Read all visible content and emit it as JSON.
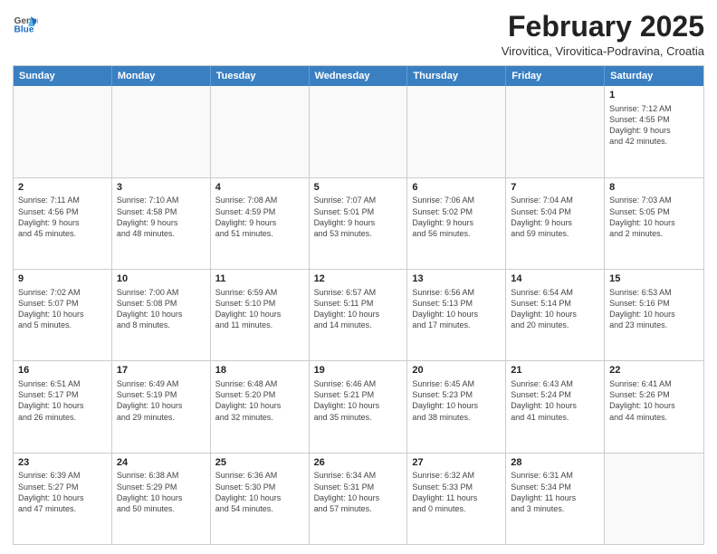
{
  "logo": {
    "general": "General",
    "blue": "Blue"
  },
  "header": {
    "month": "February 2025",
    "location": "Virovitica, Virovitica-Podravina, Croatia"
  },
  "weekdays": [
    "Sunday",
    "Monday",
    "Tuesday",
    "Wednesday",
    "Thursday",
    "Friday",
    "Saturday"
  ],
  "rows": [
    [
      {
        "day": "",
        "info": ""
      },
      {
        "day": "",
        "info": ""
      },
      {
        "day": "",
        "info": ""
      },
      {
        "day": "",
        "info": ""
      },
      {
        "day": "",
        "info": ""
      },
      {
        "day": "",
        "info": ""
      },
      {
        "day": "1",
        "info": "Sunrise: 7:12 AM\nSunset: 4:55 PM\nDaylight: 9 hours\nand 42 minutes."
      }
    ],
    [
      {
        "day": "2",
        "info": "Sunrise: 7:11 AM\nSunset: 4:56 PM\nDaylight: 9 hours\nand 45 minutes."
      },
      {
        "day": "3",
        "info": "Sunrise: 7:10 AM\nSunset: 4:58 PM\nDaylight: 9 hours\nand 48 minutes."
      },
      {
        "day": "4",
        "info": "Sunrise: 7:08 AM\nSunset: 4:59 PM\nDaylight: 9 hours\nand 51 minutes."
      },
      {
        "day": "5",
        "info": "Sunrise: 7:07 AM\nSunset: 5:01 PM\nDaylight: 9 hours\nand 53 minutes."
      },
      {
        "day": "6",
        "info": "Sunrise: 7:06 AM\nSunset: 5:02 PM\nDaylight: 9 hours\nand 56 minutes."
      },
      {
        "day": "7",
        "info": "Sunrise: 7:04 AM\nSunset: 5:04 PM\nDaylight: 9 hours\nand 59 minutes."
      },
      {
        "day": "8",
        "info": "Sunrise: 7:03 AM\nSunset: 5:05 PM\nDaylight: 10 hours\nand 2 minutes."
      }
    ],
    [
      {
        "day": "9",
        "info": "Sunrise: 7:02 AM\nSunset: 5:07 PM\nDaylight: 10 hours\nand 5 minutes."
      },
      {
        "day": "10",
        "info": "Sunrise: 7:00 AM\nSunset: 5:08 PM\nDaylight: 10 hours\nand 8 minutes."
      },
      {
        "day": "11",
        "info": "Sunrise: 6:59 AM\nSunset: 5:10 PM\nDaylight: 10 hours\nand 11 minutes."
      },
      {
        "day": "12",
        "info": "Sunrise: 6:57 AM\nSunset: 5:11 PM\nDaylight: 10 hours\nand 14 minutes."
      },
      {
        "day": "13",
        "info": "Sunrise: 6:56 AM\nSunset: 5:13 PM\nDaylight: 10 hours\nand 17 minutes."
      },
      {
        "day": "14",
        "info": "Sunrise: 6:54 AM\nSunset: 5:14 PM\nDaylight: 10 hours\nand 20 minutes."
      },
      {
        "day": "15",
        "info": "Sunrise: 6:53 AM\nSunset: 5:16 PM\nDaylight: 10 hours\nand 23 minutes."
      }
    ],
    [
      {
        "day": "16",
        "info": "Sunrise: 6:51 AM\nSunset: 5:17 PM\nDaylight: 10 hours\nand 26 minutes."
      },
      {
        "day": "17",
        "info": "Sunrise: 6:49 AM\nSunset: 5:19 PM\nDaylight: 10 hours\nand 29 minutes."
      },
      {
        "day": "18",
        "info": "Sunrise: 6:48 AM\nSunset: 5:20 PM\nDaylight: 10 hours\nand 32 minutes."
      },
      {
        "day": "19",
        "info": "Sunrise: 6:46 AM\nSunset: 5:21 PM\nDaylight: 10 hours\nand 35 minutes."
      },
      {
        "day": "20",
        "info": "Sunrise: 6:45 AM\nSunset: 5:23 PM\nDaylight: 10 hours\nand 38 minutes."
      },
      {
        "day": "21",
        "info": "Sunrise: 6:43 AM\nSunset: 5:24 PM\nDaylight: 10 hours\nand 41 minutes."
      },
      {
        "day": "22",
        "info": "Sunrise: 6:41 AM\nSunset: 5:26 PM\nDaylight: 10 hours\nand 44 minutes."
      }
    ],
    [
      {
        "day": "23",
        "info": "Sunrise: 6:39 AM\nSunset: 5:27 PM\nDaylight: 10 hours\nand 47 minutes."
      },
      {
        "day": "24",
        "info": "Sunrise: 6:38 AM\nSunset: 5:29 PM\nDaylight: 10 hours\nand 50 minutes."
      },
      {
        "day": "25",
        "info": "Sunrise: 6:36 AM\nSunset: 5:30 PM\nDaylight: 10 hours\nand 54 minutes."
      },
      {
        "day": "26",
        "info": "Sunrise: 6:34 AM\nSunset: 5:31 PM\nDaylight: 10 hours\nand 57 minutes."
      },
      {
        "day": "27",
        "info": "Sunrise: 6:32 AM\nSunset: 5:33 PM\nDaylight: 11 hours\nand 0 minutes."
      },
      {
        "day": "28",
        "info": "Sunrise: 6:31 AM\nSunset: 5:34 PM\nDaylight: 11 hours\nand 3 minutes."
      },
      {
        "day": "",
        "info": ""
      }
    ]
  ]
}
